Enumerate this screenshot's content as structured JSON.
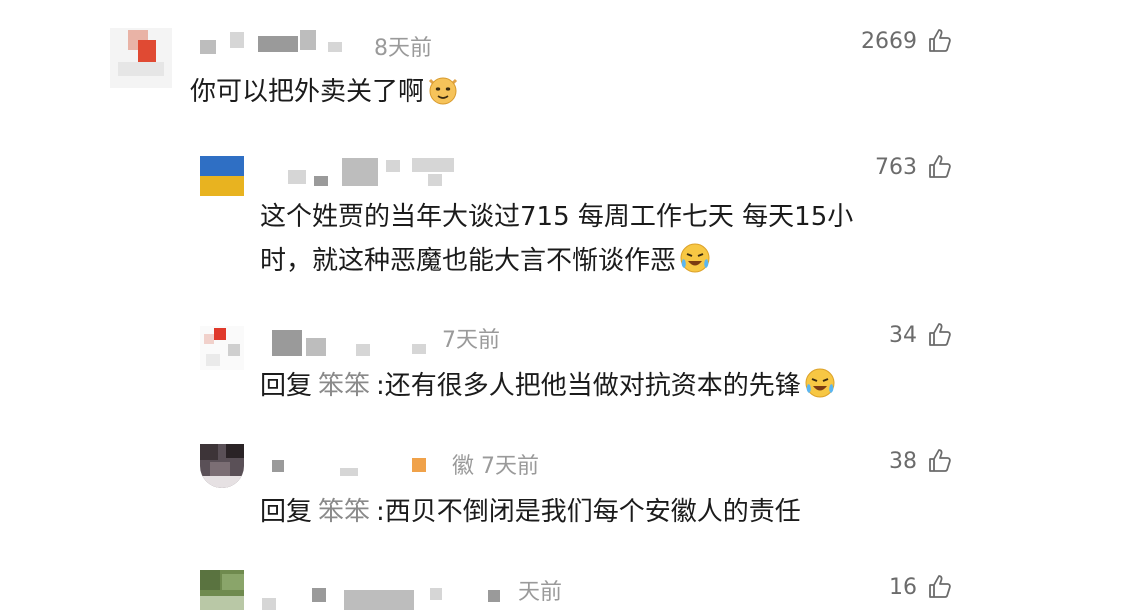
{
  "comments": [
    {
      "time": "8天前",
      "likes": "2669",
      "text": "你可以把外卖关了啊"
    },
    {
      "likes": "763",
      "text_line1": "这个姓贾的当年大谈过715 每周工作七天 每天15小",
      "text_line2": "时，就这种恶魔也能大言不惭谈作恶"
    },
    {
      "time": "7天前",
      "likes": "34",
      "reply_prefix": "回复",
      "reply_name": "笨笨",
      "reply_text": ":还有很多人把他当做对抗资本的先锋"
    },
    {
      "time": "徽 7天前",
      "likes": "38",
      "reply_prefix": "回复",
      "reply_name": "笨笨",
      "reply_text": ":西贝不倒闭是我们每个安徽人的责任"
    },
    {
      "time": "天前",
      "likes": "16"
    }
  ],
  "icons": {
    "like": "thumbs-up-icon",
    "emoji_cat": "cat-face-emoji",
    "emoji_laugh": "laughing-crying-emoji"
  },
  "colors": {
    "time": "#9a9a9a",
    "reply_name": "#8a8a8a",
    "text": "#1b1b1b"
  }
}
